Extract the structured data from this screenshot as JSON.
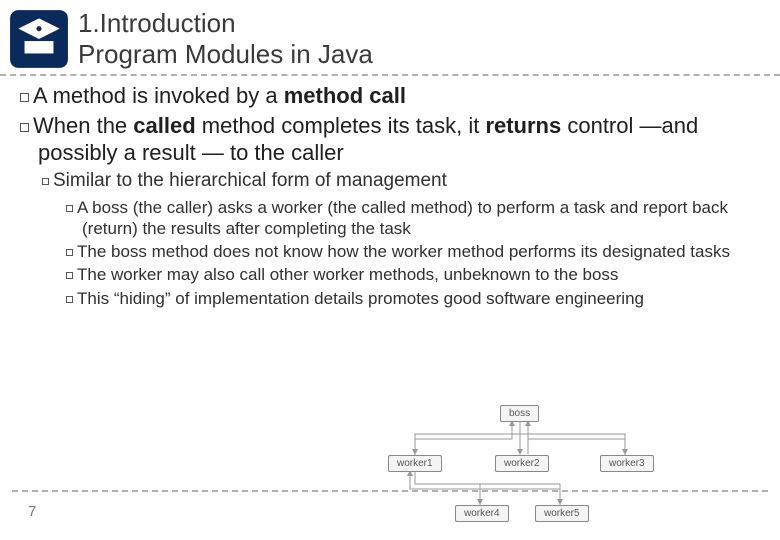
{
  "header": {
    "title1": "1.Introduction",
    "title2": "Program Modules in Java"
  },
  "bullets": {
    "b1_a_pre": "A method is invoked by a ",
    "b1_a_bold": "method call",
    "b1_b_pre": "When the ",
    "b1_b_bold1": "called",
    "b1_b_mid": " method completes its task, it ",
    "b1_b_bold2": "returns",
    "b1_b_post": " control —and possibly a result — to the caller",
    "b2": "Similar to the hierarchical form of management",
    "b3_1": "A boss (the caller) asks a worker (the called method) to perform a task and report back (return) the results after completing the task",
    "b3_2": "The boss method does not know how the worker method performs its designated tasks",
    "b3_3": "The worker may also call other worker methods, unbeknown to the boss",
    "b3_4": "This “hiding” of implementation details promotes good software engineering"
  },
  "diagram": {
    "boss": "boss",
    "w1": "worker1",
    "w2": "worker2",
    "w3": "worker3",
    "w4": "worker4",
    "w5": "worker5"
  },
  "page": "7"
}
